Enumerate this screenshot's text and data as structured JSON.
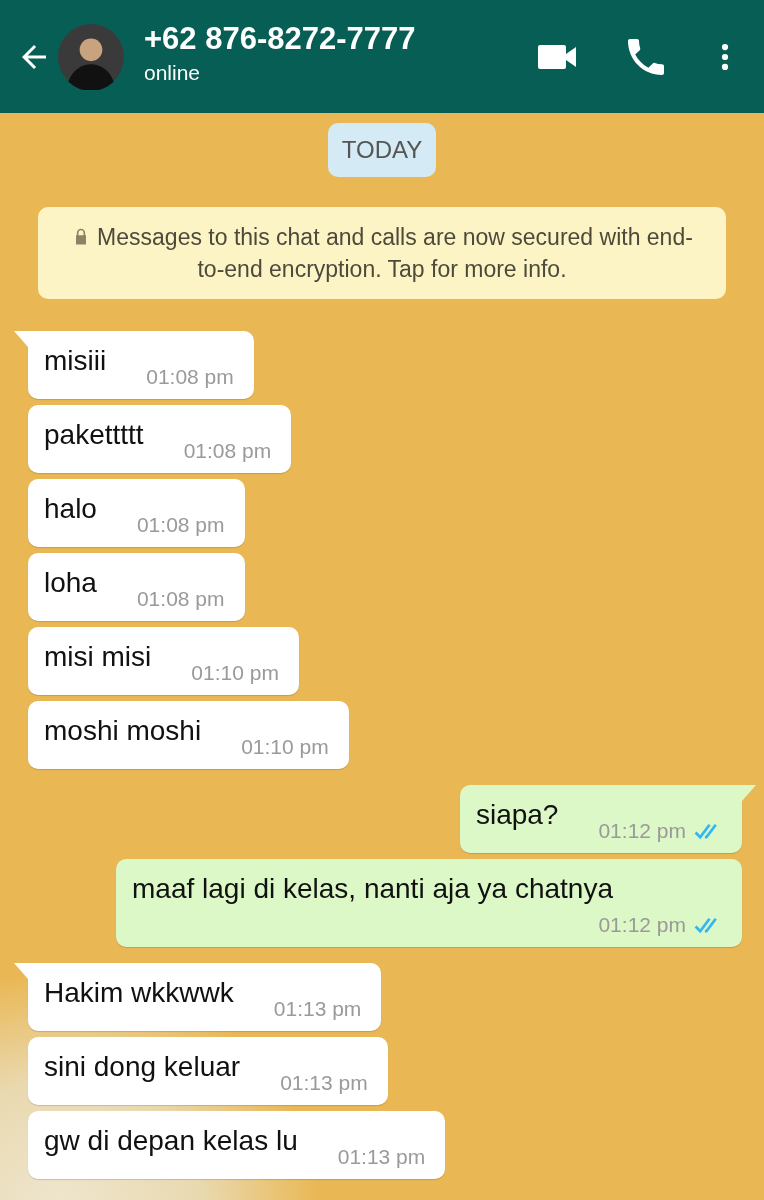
{
  "header": {
    "contact": "+62 876-8272-7777",
    "status": "online"
  },
  "date_chip": "TODAY",
  "encryption_notice": "Messages to this chat and calls are now secured with end-to-end encryption. Tap for more info.",
  "messages": [
    {
      "outgoing": false,
      "tail": true,
      "text": "misiii",
      "time": "01:08 pm"
    },
    {
      "outgoing": false,
      "tail": false,
      "text": "pakettttt",
      "time": "01:08 pm"
    },
    {
      "outgoing": false,
      "tail": false,
      "text": "halo",
      "time": "01:08 pm"
    },
    {
      "outgoing": false,
      "tail": false,
      "text": "loha",
      "time": "01:08 pm"
    },
    {
      "outgoing": false,
      "tail": false,
      "text": "misi misi",
      "time": "01:10 pm"
    },
    {
      "outgoing": false,
      "tail": false,
      "text": "moshi moshi",
      "time": "01:10 pm"
    },
    {
      "outgoing": true,
      "tail": true,
      "text": "siapa?",
      "time": "01:12 pm",
      "read": true
    },
    {
      "outgoing": true,
      "tail": false,
      "text": "maaf lagi di kelas, nanti aja ya chatnya",
      "time": "01:12 pm",
      "read": true
    },
    {
      "outgoing": false,
      "tail": true,
      "text": "Hakim wkkwwk",
      "time": "01:13 pm"
    },
    {
      "outgoing": false,
      "tail": false,
      "text": "sini dong keluar",
      "time": "01:13 pm"
    },
    {
      "outgoing": false,
      "tail": false,
      "text": "gw di depan kelas lu",
      "time": "01:13 pm"
    }
  ]
}
